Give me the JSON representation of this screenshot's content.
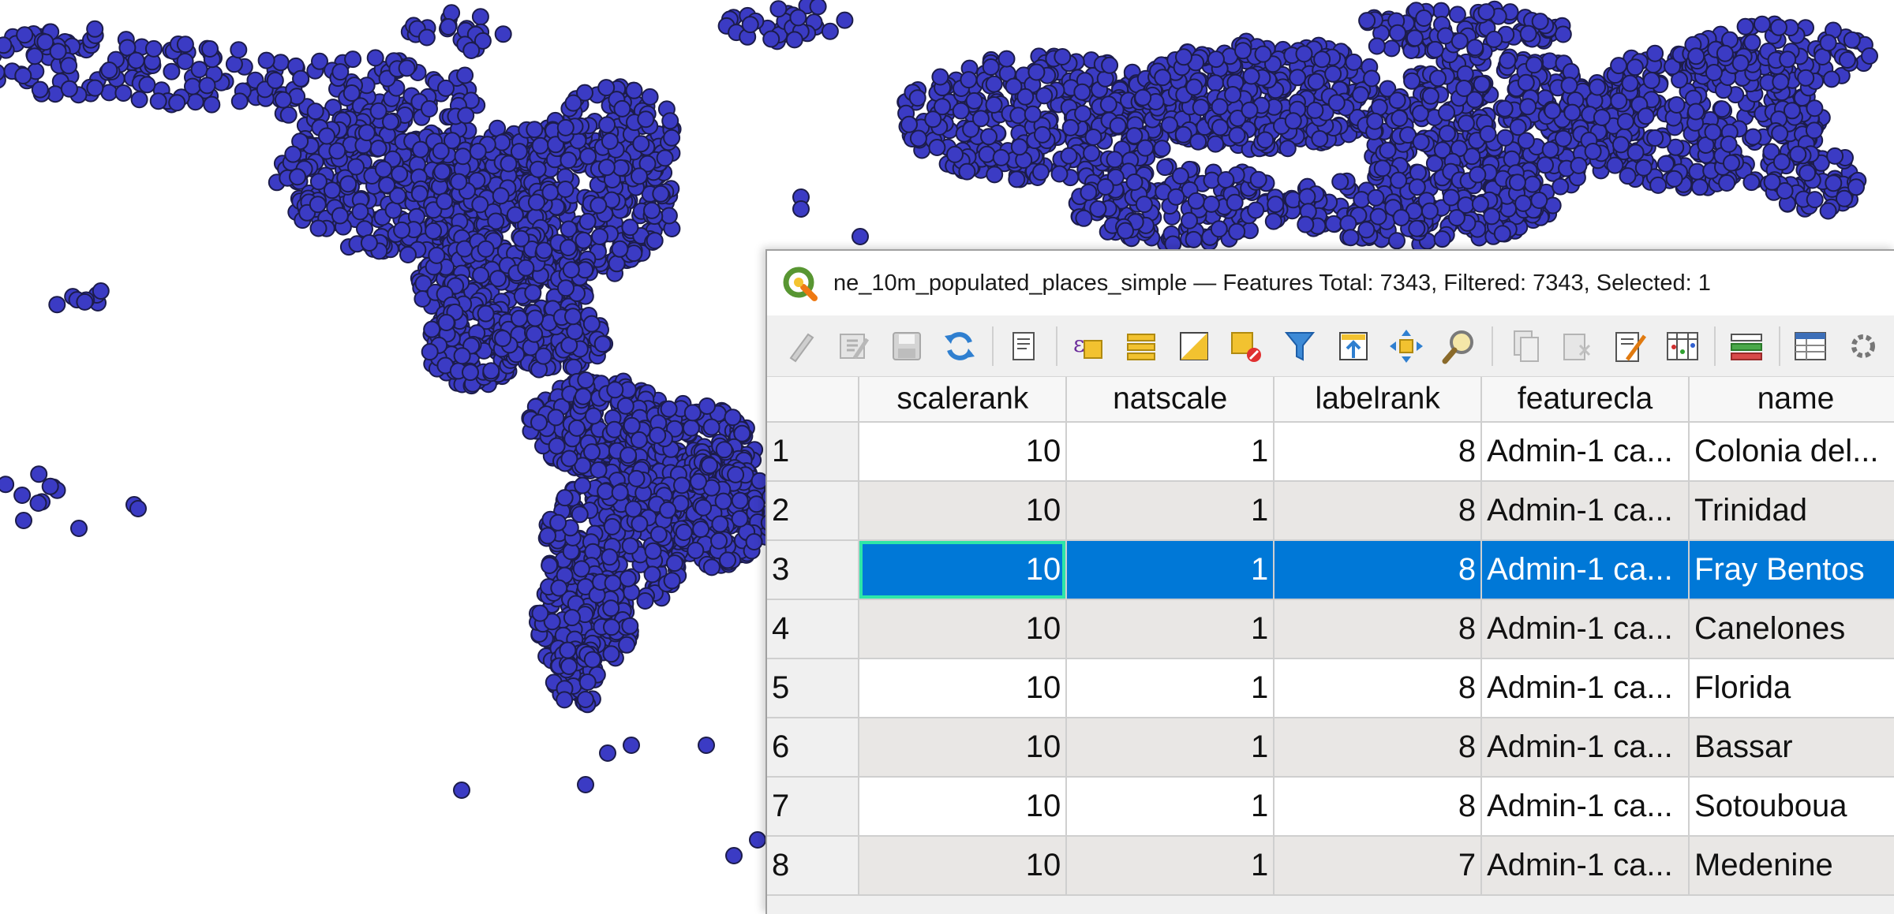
{
  "window": {
    "title": "ne_10m_populated_places_simple — Features Total: 7343, Filtered: 7343, Selected: 1"
  },
  "toolbar": {
    "buttons": [
      {
        "name": "toggle-editing-icon"
      },
      {
        "name": "toggle-multi-edit-icon"
      },
      {
        "name": "save-edits-icon"
      },
      {
        "name": "reload-table-icon"
      },
      {
        "name": "add-feature-icon"
      },
      {
        "name": "select-by-expression-icon"
      },
      {
        "name": "select-all-icon"
      },
      {
        "name": "invert-selection-icon"
      },
      {
        "name": "deselect-all-icon"
      },
      {
        "name": "filter-icon"
      },
      {
        "name": "move-selection-to-top-icon"
      },
      {
        "name": "pan-to-selected-icon"
      },
      {
        "name": "zoom-to-selected-icon"
      },
      {
        "name": "copy-features-icon"
      },
      {
        "name": "paste-features-icon"
      },
      {
        "name": "new-field-icon"
      },
      {
        "name": "delete-field-icon"
      },
      {
        "name": "field-calculator-icon"
      },
      {
        "name": "conditional-formatting-icon"
      },
      {
        "name": "dock-window-icon"
      }
    ]
  },
  "table": {
    "columns": [
      "",
      "scalerank",
      "natscale",
      "labelrank",
      "featurecla",
      "name"
    ],
    "rows": [
      {
        "id": "1",
        "scalerank": "10",
        "natscale": "1",
        "labelrank": "8",
        "featurecla": "Admin-1 ca...",
        "name": "Colonia del..."
      },
      {
        "id": "2",
        "scalerank": "10",
        "natscale": "1",
        "labelrank": "8",
        "featurecla": "Admin-1 ca...",
        "name": "Trinidad"
      },
      {
        "id": "3",
        "scalerank": "10",
        "natscale": "1",
        "labelrank": "8",
        "featurecla": "Admin-1 ca...",
        "name": "Fray Bentos"
      },
      {
        "id": "4",
        "scalerank": "10",
        "natscale": "1",
        "labelrank": "8",
        "featurecla": "Admin-1 ca...",
        "name": "Canelones"
      },
      {
        "id": "5",
        "scalerank": "10",
        "natscale": "1",
        "labelrank": "8",
        "featurecla": "Admin-1 ca...",
        "name": "Florida"
      },
      {
        "id": "6",
        "scalerank": "10",
        "natscale": "1",
        "labelrank": "8",
        "featurecla": "Admin-1 ca...",
        "name": "Bassar"
      },
      {
        "id": "7",
        "scalerank": "10",
        "natscale": "1",
        "labelrank": "8",
        "featurecla": "Admin-1 ca...",
        "name": "Sotouboua"
      },
      {
        "id": "8",
        "scalerank": "10",
        "natscale": "1",
        "labelrank": "7",
        "featurecla": "Admin-1 ca...",
        "name": "Medenine"
      }
    ],
    "selected_row_index": 2
  },
  "colors": {
    "point_fill": "#3b3bc4",
    "selection": "#0078d7",
    "current_cell_border": "#2ee6a8"
  }
}
